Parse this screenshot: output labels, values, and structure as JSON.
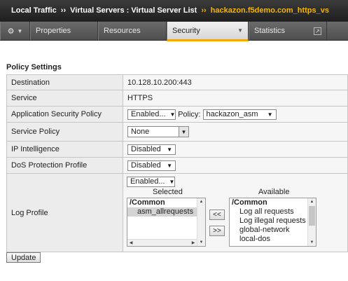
{
  "breadcrumb": {
    "items": [
      "Local Traffic",
      "Virtual Servers : Virtual Server List"
    ],
    "current": "hackazon.f5demo.com_https_vs",
    "separator": "››"
  },
  "tabs": {
    "gear_icon": "gear-icon",
    "items": [
      {
        "label": "Properties",
        "active": false
      },
      {
        "label": "Resources",
        "active": false
      },
      {
        "label": "Security",
        "active": true,
        "has_dropdown": true
      },
      {
        "label": "Statistics",
        "active": false,
        "has_popout": true
      }
    ]
  },
  "section": {
    "title": "Policy Settings"
  },
  "settings": {
    "destination": {
      "label": "Destination",
      "value": "10.128.10.200:443"
    },
    "service": {
      "label": "Service",
      "value": "HTTPS"
    },
    "asp": {
      "label": "Application Security Policy",
      "state": "Enabled...",
      "policy_label": "Policy:",
      "policy": "hackazon_asm"
    },
    "service_policy": {
      "label": "Service Policy",
      "value": "None"
    },
    "ip_intel": {
      "label": "IP Intelligence",
      "value": "Disabled"
    },
    "dos": {
      "label": "DoS Protection Profile",
      "value": "Disabled"
    },
    "log": {
      "label": "Log Profile",
      "state": "Enabled...",
      "selected_header": "Selected",
      "available_header": "Available",
      "selected_group": "/Common",
      "selected_items": [
        "asm_allrequests"
      ],
      "available_group": "/Common",
      "available_items": [
        "Log all requests",
        "Log illegal requests",
        "global-network",
        "local-dos"
      ],
      "add_label": "<<",
      "remove_label": ">>"
    }
  },
  "update_label": "Update",
  "colors": {
    "accent": "#f5b400",
    "header_bg": "#2b2b2b",
    "tab_bg": "#5a5a5a"
  }
}
